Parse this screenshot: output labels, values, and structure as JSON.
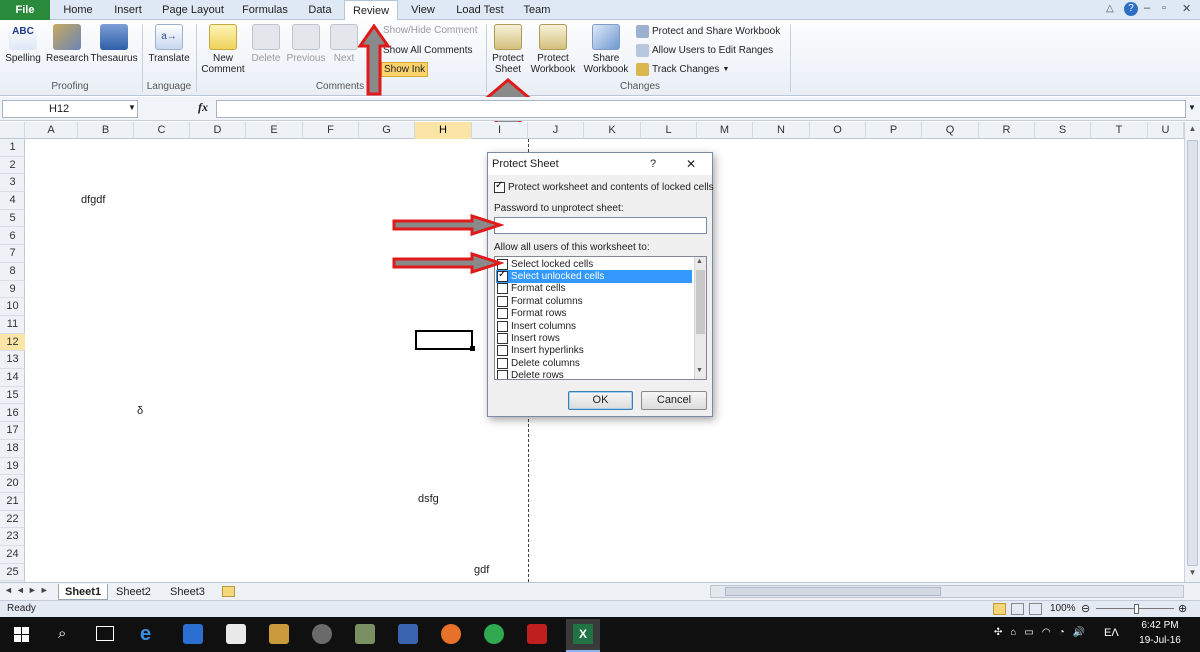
{
  "tabs": [
    "File",
    "Home",
    "Insert",
    "Page Layout",
    "Formulas",
    "Data",
    "Review",
    "View",
    "Load Test",
    "Team"
  ],
  "active_tab": "Review",
  "ribbon": {
    "proofing": {
      "label": "Proofing",
      "spelling": "Spelling",
      "research": "Research",
      "thesaurus": "Thesaurus"
    },
    "language": {
      "label": "Language",
      "translate": "Translate"
    },
    "comments": {
      "label": "Comments",
      "new_comment_1": "New",
      "new_comment_2": "Comment",
      "delete": "Delete",
      "previous": "Previous",
      "next": "Next",
      "show_hide_comment": "Show/Hide Comment",
      "show_all_comments": "Show All Comments",
      "show_ink": "Show Ink"
    },
    "changes": {
      "label": "Changes",
      "protect_sheet_1": "Protect",
      "protect_sheet_2": "Sheet",
      "protect_workbook_1": "Protect",
      "protect_workbook_2": "Workbook",
      "share_workbook_1": "Share",
      "share_workbook_2": "Workbook",
      "protect_share": "Protect and Share Workbook",
      "allow_edit_ranges": "Allow Users to Edit Ranges",
      "track_changes": "Track Changes"
    }
  },
  "formula_bar": {
    "name_box": "H12",
    "fx": "fx",
    "value": ""
  },
  "columns": [
    "A",
    "B",
    "C",
    "D",
    "E",
    "F",
    "G",
    "H",
    "I",
    "J",
    "K",
    "L",
    "M",
    "N",
    "O",
    "P",
    "Q",
    "R",
    "S",
    "T",
    "U"
  ],
  "rows": [
    "1",
    "2",
    "3",
    "4",
    "5",
    "6",
    "7",
    "8",
    "9",
    "10",
    "11",
    "12",
    "13",
    "14",
    "15",
    "16",
    "17",
    "18",
    "19",
    "20",
    "21",
    "22",
    "23",
    "24",
    "25"
  ],
  "cells": {
    "b4": "dfgdf",
    "c16": "δ",
    "h21": "dsfg",
    "i25": "gdf"
  },
  "dialog": {
    "title": "Protect Sheet",
    "help": "?",
    "close": "✕",
    "protect_checkbox": "Protect worksheet and contents of locked cells",
    "password_label": "Password to unprotect sheet:",
    "password_value": "",
    "allow_label": "Allow all users of this worksheet to:",
    "permissions": [
      {
        "label": "Select locked cells",
        "checked": false
      },
      {
        "label": "Select unlocked cells",
        "checked": true
      },
      {
        "label": "Format cells",
        "checked": false
      },
      {
        "label": "Format columns",
        "checked": false
      },
      {
        "label": "Format rows",
        "checked": false
      },
      {
        "label": "Insert columns",
        "checked": false
      },
      {
        "label": "Insert rows",
        "checked": false
      },
      {
        "label": "Insert hyperlinks",
        "checked": false
      },
      {
        "label": "Delete columns",
        "checked": false
      },
      {
        "label": "Delete rows",
        "checked": false
      }
    ],
    "ok": "OK",
    "cancel": "Cancel"
  },
  "sheets": [
    "Sheet1",
    "Sheet2",
    "Sheet3"
  ],
  "status": {
    "ready": "Ready",
    "zoom": "100%"
  },
  "taskbar": {
    "time": "6:42 PM",
    "date": "19-Jul-16",
    "lang": "EΛ"
  },
  "colors": {
    "file_tab": "#2a8a3b",
    "selection": "#fbe5a6",
    "highlight": "#3399ff",
    "annotation_arrow": "#e01a1a"
  }
}
